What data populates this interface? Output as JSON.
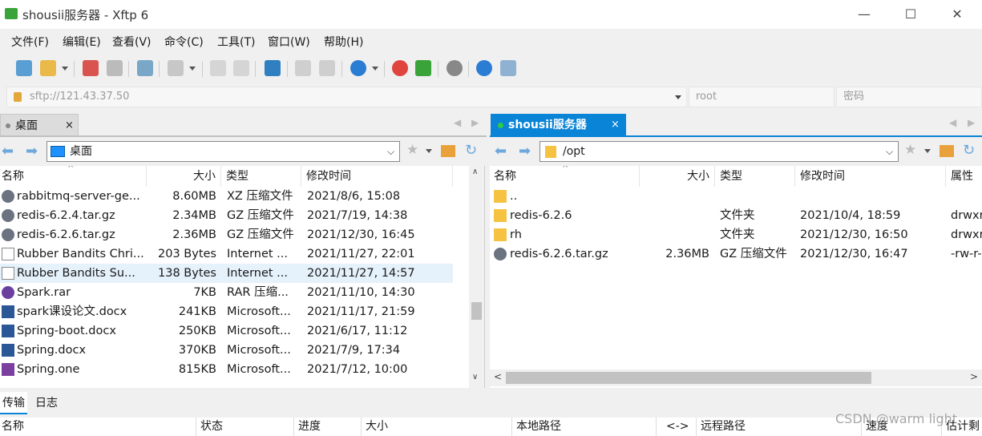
{
  "window": {
    "title": "shousii服务器   - Xftp 6",
    "minimize": "—",
    "maximize": "☐",
    "close": "✕"
  },
  "menu": [
    "文件(F)",
    "编辑(E)",
    "查看(V)",
    "命令(C)",
    "工具(T)",
    "窗口(W)",
    "帮助(H)"
  ],
  "address": {
    "url": "sftp://121.43.37.50",
    "user_placeholder": "root",
    "password_placeholder": "密码"
  },
  "left": {
    "tab_label": "桌面",
    "tab_close": "×",
    "path": "桌面",
    "columns": [
      "名称",
      "大小",
      "类型",
      "修改时间"
    ],
    "files": [
      {
        "name": "rabbitmq-server-ge...",
        "size": "8.60MB",
        "type": "XZ 压缩文件",
        "modified": "2021/8/6, 15:08",
        "icon": "archive-icon"
      },
      {
        "name": "redis-6.2.4.tar.gz",
        "size": "2.34MB",
        "type": "GZ 压缩文件",
        "modified": "2021/7/19, 14:38",
        "icon": "archive-icon"
      },
      {
        "name": "redis-6.2.6.tar.gz",
        "size": "2.36MB",
        "type": "GZ 压缩文件",
        "modified": "2021/12/30, 16:45",
        "icon": "archive-icon"
      },
      {
        "name": "Rubber Bandits Chri...",
        "size": "203 Bytes",
        "type": "Internet ...",
        "modified": "2021/11/27, 22:01",
        "icon": "html-icon"
      },
      {
        "name": "Rubber Bandits Su...",
        "size": "138 Bytes",
        "type": "Internet ...",
        "modified": "2021/11/27, 14:57",
        "icon": "html-icon"
      },
      {
        "name": "Spark.rar",
        "size": "7KB",
        "type": "RAR 压缩...",
        "modified": "2021/11/10, 14:30",
        "icon": "rar-icon"
      },
      {
        "name": "spark课设论文.docx",
        "size": "241KB",
        "type": "Microsoft...",
        "modified": "2021/11/17, 21:59",
        "icon": "doc-icon"
      },
      {
        "name": "Spring-boot.docx",
        "size": "250KB",
        "type": "Microsoft...",
        "modified": "2021/6/17, 11:12",
        "icon": "doc-icon"
      },
      {
        "name": "Spring.docx",
        "size": "370KB",
        "type": "Microsoft...",
        "modified": "2021/7/9, 17:34",
        "icon": "doc-icon"
      },
      {
        "name": "Spring.one",
        "size": "815KB",
        "type": "Microsoft...",
        "modified": "2021/7/12, 10:00",
        "icon": "note-icon"
      }
    ],
    "selected_index": 4
  },
  "right": {
    "tab_label": "shousii服务器",
    "tab_close": "×",
    "path": "/opt",
    "columns": [
      "名称",
      "大小",
      "类型",
      "修改时间",
      "属性"
    ],
    "files": [
      {
        "name": "..",
        "size": "",
        "type": "",
        "modified": "",
        "attrs": "",
        "icon": "folder-icon"
      },
      {
        "name": "redis-6.2.6",
        "size": "",
        "type": "文件夹",
        "modified": "2021/10/4, 18:59",
        "attrs": "drwxr",
        "icon": "folder-icon"
      },
      {
        "name": "rh",
        "size": "",
        "type": "文件夹",
        "modified": "2021/12/30, 16:50",
        "attrs": "drwxr",
        "icon": "folder-icon"
      },
      {
        "name": "redis-6.2.6.tar.gz",
        "size": "2.36MB",
        "type": "GZ 压缩文件",
        "modified": "2021/12/30, 16:47",
        "attrs": "-rw-r-",
        "icon": "archive-icon"
      }
    ]
  },
  "bottom": {
    "tabs": [
      "传输",
      "日志"
    ],
    "columns": [
      "名称",
      "状态",
      "进度",
      "大小",
      "本地路径",
      "<->",
      "远程路径",
      "速度",
      "估计剩"
    ],
    "watermark": "CSDN @warm light"
  },
  "colors": {
    "accent": "#0a84d6",
    "selected_row": "#e5f1fb",
    "tab_active": "#0a84d6"
  }
}
